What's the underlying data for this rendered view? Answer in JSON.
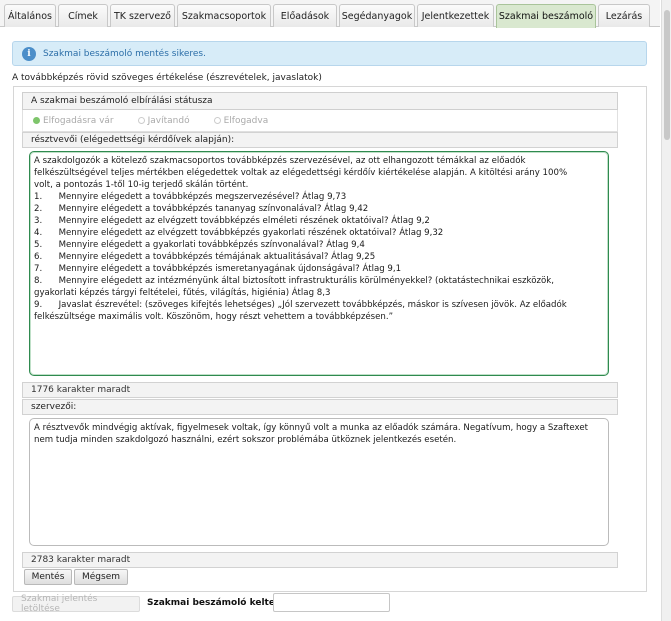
{
  "tabs": [
    {
      "label": "Általános"
    },
    {
      "label": "Címek"
    },
    {
      "label": "TK szervező"
    },
    {
      "label": "Szakmacsoportok"
    },
    {
      "label": "Előadások"
    },
    {
      "label": "Segédanyagok"
    },
    {
      "label": "Jelentkezettek"
    },
    {
      "label": "Szakmai beszámoló"
    },
    {
      "label": "Lezárás"
    }
  ],
  "info": {
    "message": "Szakmai beszámoló mentés sikeres."
  },
  "section_label": "A továbbképzés rövid szöveges értékelése (észrevételek, javaslatok)",
  "status": {
    "heading": "A szakmai beszámoló elbírálási státusza",
    "options": [
      {
        "label": "Elfogadásra vár",
        "selected": true
      },
      {
        "label": "Javítandó",
        "selected": false
      },
      {
        "label": "Elfogadva",
        "selected": false
      }
    ]
  },
  "participants": {
    "label": "résztvevői (elégedettségi kérdőívek alapján):",
    "lines": [
      "A szakdolgozók a kötelező szakmacsoportos továbbképzés szervezésével, az ott elhangozott témákkal az előadók",
      "felkészültségével teljes mértékben elégedettek voltak az elégedettségi kérdőív kiértékelése alapján. A kitöltési arány 100%",
      "volt, a pontozás 1-től 10-ig terjedő skálán történt.",
      "1.      Mennyire elégedett a továbbképzés megszervezésével? Átlag 9,73",
      "2.      Mennyire elégedett a továbbképzés tananyag színvonalával? Átlag 9,42",
      "3.      Mennyire elégedett az elvégzett továbbképzés elméleti részének oktatóival? Átlag 9,2",
      "4.      Mennyire elégedett az elvégzett továbbképzés gyakorlati részének oktatóival? Átlag 9,32",
      "5.      Mennyire elégedett a gyakorlati továbbképzés színvonalával? Átlag 9,4",
      "6.      Mennyire elégedett a továbbképzés témájának aktualitásával? Átlag 9,25",
      "7.      Mennyire elégedett a továbbképzés ismeretanyagának újdonságával? Átlag 9,1",
      "8.      Mennyire elégedett az intézményünk által biztosított infrastrukturális körülményekkel? (oktatástechnikai eszközök,",
      "gyakorlati képzés tárgyi feltételei, fűtés, világítás, higiénia) Átlag 8,3",
      "9.      Javaslat észrevétel: (szöveges kifejtés lehetséges) „Jól szervezett továbbképzés, máskor is szívesen jövök. Az előadók",
      "felkészültsége maximális volt. Köszönöm, hogy részt vehettem a továbbképzésen.”"
    ],
    "counter": "1776 karakter maradt"
  },
  "organizers": {
    "label": "szervezői:",
    "lines": [
      "A résztvevők mindvégig aktívak, figyelmesek voltak, így könnyű volt a munka az előadók számára. Negatívum, hogy a Szaftexet",
      "nem tudja minden szakdolgozó használni, ezért sokszor problémába ütköznek jelentkezés esetén."
    ],
    "counter": "2783 karakter maradt"
  },
  "buttons": {
    "save": "Mentés",
    "cancel": "Mégsem",
    "download": "Szakmai jelentés letöltése"
  },
  "date": {
    "label": "Szakmai beszámoló keltezése:",
    "value": ""
  },
  "colors": {
    "active_tab": "#d9e8cf",
    "info_bg": "#d7ecf8",
    "info_text": "#2d6fa8",
    "focus_border": "#2f8a4f"
  }
}
